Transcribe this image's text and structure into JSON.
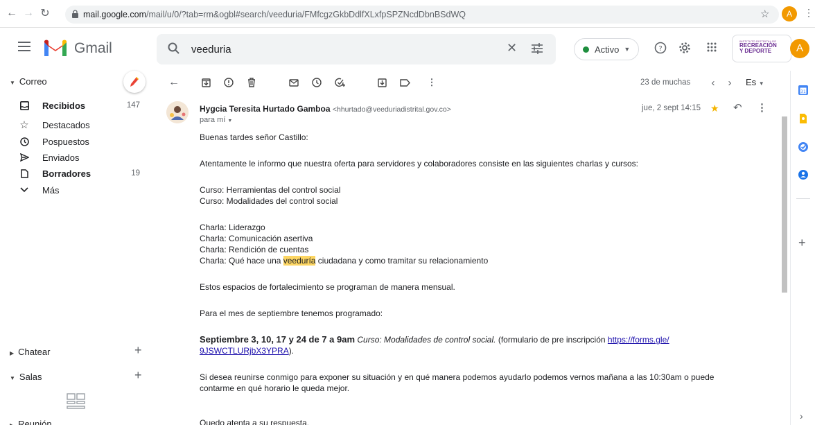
{
  "browser": {
    "url_host": "mail.google.com",
    "url_path": "/mail/u/0/?tab=rm&ogbl#search/veeduria/FMfcgzGkbDdlfXLxfpSPZNcdDbnBSdWQ",
    "profile_initial": "A"
  },
  "header": {
    "app_name": "Gmail",
    "search_value": "veeduria",
    "status_label": "Activo",
    "org_line1": "INSTITUTO DISTRITAL DE",
    "org_line2a": "RECREACIÓN",
    "org_line2b": "Y DEPORTE",
    "avatar_initial": "A"
  },
  "sidebar": {
    "mail_section": "Correo",
    "items": [
      {
        "label": "Recibidos",
        "count": "147",
        "bold": true,
        "icon": "inbox-icon"
      },
      {
        "label": "Destacados",
        "count": "",
        "bold": false,
        "icon": "star-icon"
      },
      {
        "label": "Pospuestos",
        "count": "",
        "bold": false,
        "icon": "clock-icon"
      },
      {
        "label": "Enviados",
        "count": "",
        "bold": false,
        "icon": "send-icon"
      },
      {
        "label": "Borradores",
        "count": "19",
        "bold": true,
        "icon": "draft-icon"
      },
      {
        "label": "Más",
        "count": "",
        "bold": false,
        "icon": "chevron-down-icon"
      }
    ],
    "chat_section": "Chatear",
    "rooms_section": "Salas",
    "meet_section": "Reunión"
  },
  "toolbar": {
    "page_count": "23 de muchas",
    "lang": "Es"
  },
  "message": {
    "sender_name": "Hygcia Teresita Hurtado Gamboa",
    "sender_email": "<hhurtado@veeduriadistrital.gov.co>",
    "to": "para mí",
    "date": "jue, 2 sept 14:15",
    "greeting": "Buenas tardes señor Castillo:",
    "intro": "Atentamente le informo que nuestra oferta para servidores y colaboradores consiste en las siguientes charlas y cursos:",
    "courses": [
      "Curso: Herramientas del control social",
      "Curso: Modalidades del control social"
    ],
    "talks": [
      "Charla: Liderazgo",
      "Charla: Comunicación asertiva",
      "Charla: Rendición de cuentas"
    ],
    "talk4_pre": "Charla: Qué hace una ",
    "talk4_hl": "veeduría",
    "talk4_post": " ciudadana y como tramitar su relacionamiento",
    "monthly": "Estos espacios de fortalecimiento se programan de manera mensual.",
    "september_intro": "Para el mes de septiembre tenemos programado:",
    "sched_bold": "Septiembre 3, 10, 17 y 24 de 7 a 9am",
    "sched_italic": "Curso: Modalidades de control social.",
    "sched_plain": "(formulario de pre inscripción",
    "link_part1": "https://forms.gle/",
    "link_part2": "9JSWCTLURjbX3YPRA",
    "link_after": ").",
    "meeting_line1": "Si desea reunirse conmigo para exponer su situación y en qué manera podemos ayudarlo podemos vernos mañana a las 10:30am o puede",
    "meeting_line2": "contarme en qué horario le queda mejor.",
    "closing": "Quedo atenta a su respuesta."
  }
}
